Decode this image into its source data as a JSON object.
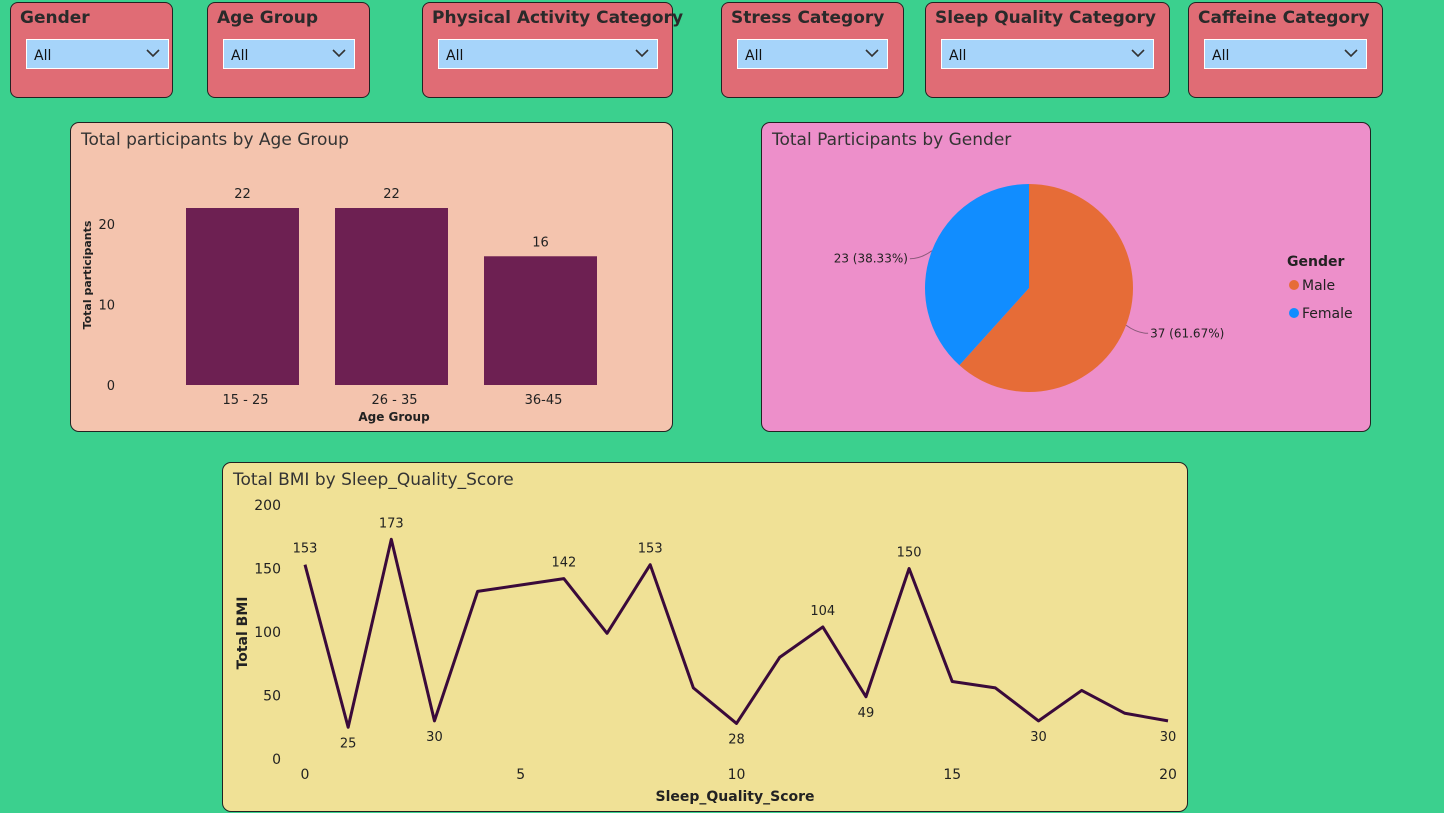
{
  "slicers": [
    {
      "title": "Gender",
      "value": "All"
    },
    {
      "title": "Age Group",
      "value": "All"
    },
    {
      "title": "Physical Activity Category",
      "value": "All"
    },
    {
      "title": "Stress Category",
      "value": "All"
    },
    {
      "title": "Sleep Quality Category",
      "value": "All"
    },
    {
      "title": "Caffeine Category",
      "value": "All"
    }
  ],
  "age_chart": {
    "title": "Total participants by Age Group"
  },
  "gender_chart": {
    "title": "Total Participants by Gender"
  },
  "bmi_chart": {
    "title": "Total BMI by Sleep_Quality_Score"
  },
  "colors": {
    "background": "#3bd08e",
    "slicer": "#e06c75",
    "dropdown": "#a6d4fa",
    "bar": "#6d2052",
    "male": "#e66c37",
    "female": "#118dff",
    "line": "#3a0a3a",
    "age_card": "#f4c4ae",
    "gender_card": "#ed8fca",
    "bmi_card": "#f0e196"
  },
  "chart_data": [
    {
      "type": "bar",
      "title": "Total participants by Age Group",
      "xlabel": "Age Group",
      "ylabel": "Total participants",
      "categories": [
        "15 - 25",
        "26 - 35",
        "36-45"
      ],
      "values": [
        22,
        22,
        16
      ],
      "ylim": [
        0,
        22
      ],
      "yticks": [
        0,
        10,
        20
      ],
      "data_labels": true
    },
    {
      "type": "pie",
      "title": "Total Participants by Gender",
      "legend_title": "Gender",
      "legend_position": "right",
      "slices": [
        {
          "name": "Male",
          "value": 37,
          "label": "37 (61.67%)",
          "color": "#e66c37"
        },
        {
          "name": "Female",
          "value": 23,
          "label": "23 (38.33%)",
          "color": "#118dff"
        }
      ]
    },
    {
      "type": "line",
      "title": "Total BMI by Sleep_Quality_Score",
      "xlabel": "Sleep_Quality_Score",
      "ylabel": "Total BMI",
      "x": [
        0,
        1,
        2,
        3,
        4,
        5,
        6,
        7,
        8,
        9,
        10,
        11,
        12,
        13,
        14,
        15,
        16,
        17,
        18,
        19,
        20
      ],
      "y": [
        153,
        25,
        173,
        30,
        132,
        137,
        142,
        99,
        153,
        56,
        28,
        80,
        104,
        49,
        150,
        61,
        56,
        30,
        54,
        36,
        30
      ],
      "labeled_points": [
        0,
        1,
        2,
        3,
        6,
        8,
        10,
        12,
        13,
        14,
        17,
        20
      ],
      "xlim": [
        0,
        20
      ],
      "ylim": [
        0,
        200
      ],
      "xticks": [
        0,
        5,
        10,
        15,
        20
      ],
      "yticks": [
        0,
        50,
        100,
        150,
        200
      ]
    }
  ]
}
